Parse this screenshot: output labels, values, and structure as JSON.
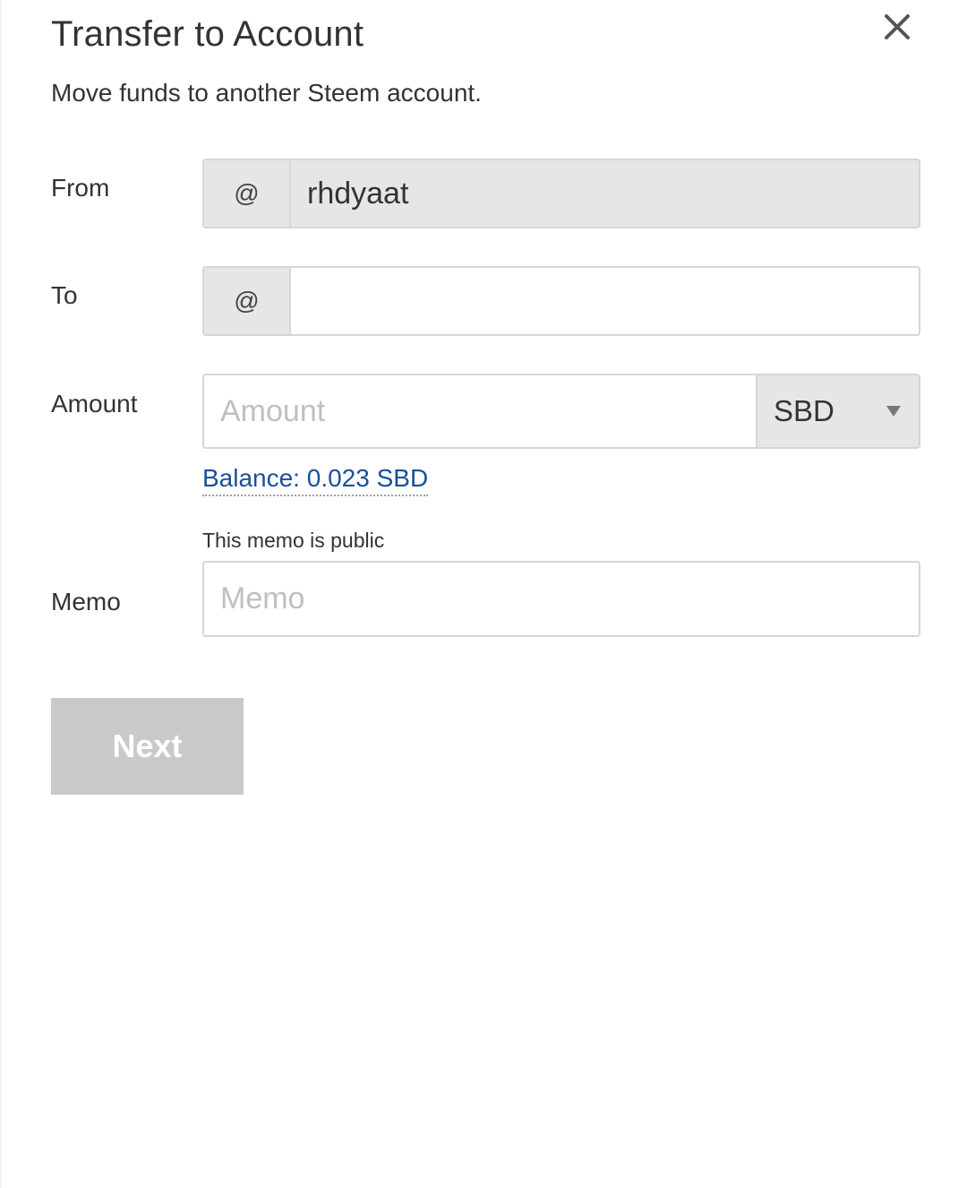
{
  "modal": {
    "title": "Transfer to Account",
    "subtitle": "Move funds to another Steem account."
  },
  "form": {
    "from": {
      "label": "From",
      "prefix": "@",
      "value": "rhdyaat"
    },
    "to": {
      "label": "To",
      "prefix": "@",
      "value": "",
      "placeholder": ""
    },
    "amount": {
      "label": "Amount",
      "value": "",
      "placeholder": "Amount",
      "asset": "SBD"
    },
    "balance": "Balance: 0.023 SBD",
    "memo": {
      "label": "Memo",
      "note": "This memo is public",
      "value": "",
      "placeholder": "Memo"
    },
    "next_label": "Next"
  },
  "icons": {
    "close": "close-icon",
    "asset_dropdown": "chevron-down-icon"
  },
  "colors": {
    "balance_link": "#1a5099",
    "disabled_button": "#c8c9cb",
    "addon_background": "#e6e6e6"
  }
}
